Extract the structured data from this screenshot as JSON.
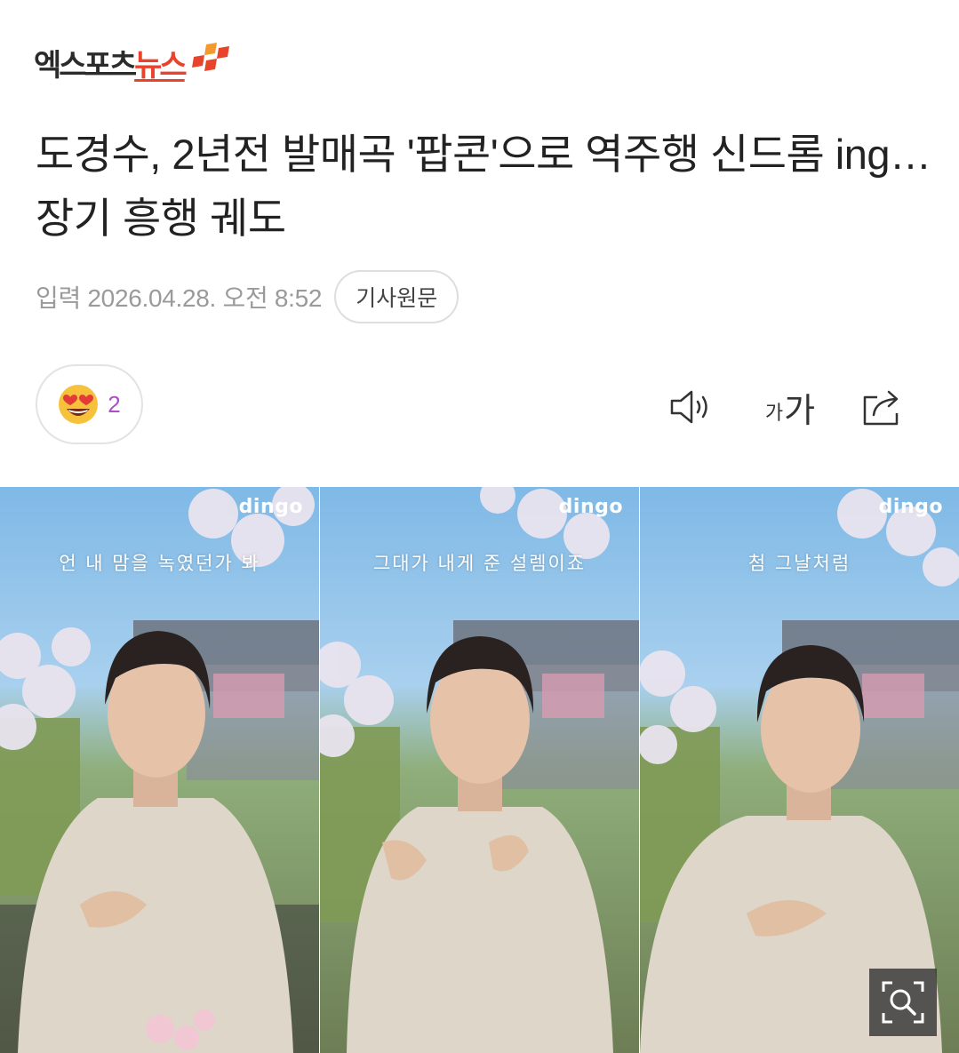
{
  "brand": {
    "name_dark": "엑스포츠",
    "name_red": "뉴스",
    "colors": {
      "dark": "#2b2b2b",
      "red": "#e8432b",
      "orange": "#f29a2e"
    }
  },
  "article": {
    "headline": "도경수, 2년전 발매곡 '팝콘'으로 역주행 신드롬 ing…장기 흥행 궤도",
    "published": "입력 2026.04.28. 오전 8:52",
    "source_button": "기사원문"
  },
  "reaction": {
    "icon": "heart-eyes-emoji-icon",
    "count": "2",
    "count_color": "#b04cc9"
  },
  "toolbar": {
    "speaker_icon": "speaker-icon",
    "font_small": "가",
    "font_big": "가",
    "share_icon": "share-icon"
  },
  "photo": {
    "panels": [
      {
        "watermark": "dingo",
        "subtitle": "언 내 맘을 녹였던가 봐"
      },
      {
        "watermark": "dingo",
        "subtitle": "그대가 내게 준 설렘이죠"
      },
      {
        "watermark": "dingo",
        "subtitle": "첨 그날처럼"
      }
    ],
    "zoom_icon": "zoom-icon"
  }
}
